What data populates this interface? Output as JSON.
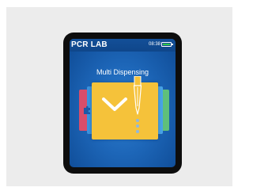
{
  "device": {
    "app_title": "PCR LAB",
    "clock": "08:38",
    "battery_level": 1.0,
    "mode_title": "Multi Dispensing"
  },
  "icons": {
    "main_card": "chevron-down-icon",
    "tool": "pipette-icon",
    "side_card": "puzzle-icon"
  },
  "colors": {
    "screen_blue": "#1d66b8",
    "main_card": "#f5c23a",
    "battery": "#2fc84a",
    "card_red": "#d94d6a",
    "card_green": "#5fbf7a"
  }
}
